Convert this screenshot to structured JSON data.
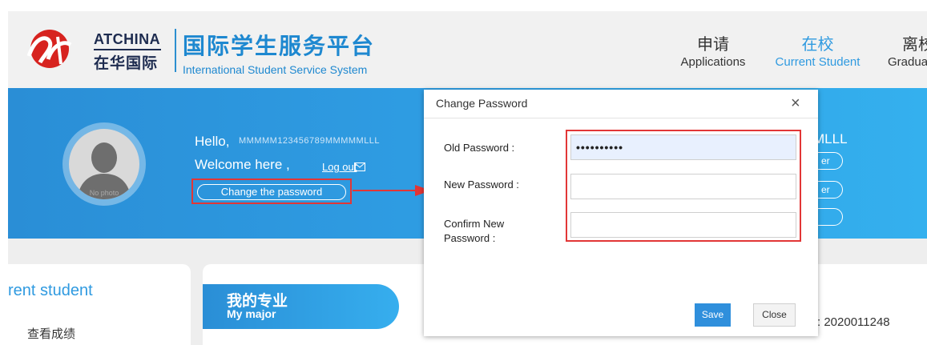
{
  "header": {
    "brand_en": "ATCHINA",
    "brand_cn": "在华国际",
    "system_cn": "国际学生服务平台",
    "system_en": "International Student Service System",
    "nav": [
      {
        "cn": "申请",
        "en": "Applications",
        "active": false
      },
      {
        "cn": "在校",
        "en": "Current Student",
        "active": true
      },
      {
        "cn": "离校",
        "en": "Graduat",
        "active": false
      }
    ]
  },
  "banner": {
    "hello": "Hello,",
    "hello_name": "MMMMM123456789MMMMMLLL",
    "welcome": "Welcome here ,",
    "logout": "Log out",
    "change_password": "Change the password",
    "avatar_caption": "No photo",
    "right_name": "MLLL",
    "pill_1": "er",
    "pill_2": "er",
    "pill_3": ""
  },
  "sidebar": {
    "title": "rent student",
    "item": "查看成绩"
  },
  "main": {
    "major_cn": "我的专业",
    "major_en": "My major",
    "student_id": ": 2020011248"
  },
  "modal": {
    "title": "Change Password",
    "close_glyph": "×",
    "old_label": "Old Password :",
    "old_value": "••••••••••",
    "new_label": "New Password :",
    "new_value": "",
    "confirm_label": "Confirm New Password :",
    "confirm_value": "",
    "save": "Save",
    "close": "Close"
  },
  "colors": {
    "accent": "#2f9ae0",
    "banner_start": "#2a8ed6",
    "highlight_red": "#e23636",
    "save_button": "#2f8fdc"
  }
}
